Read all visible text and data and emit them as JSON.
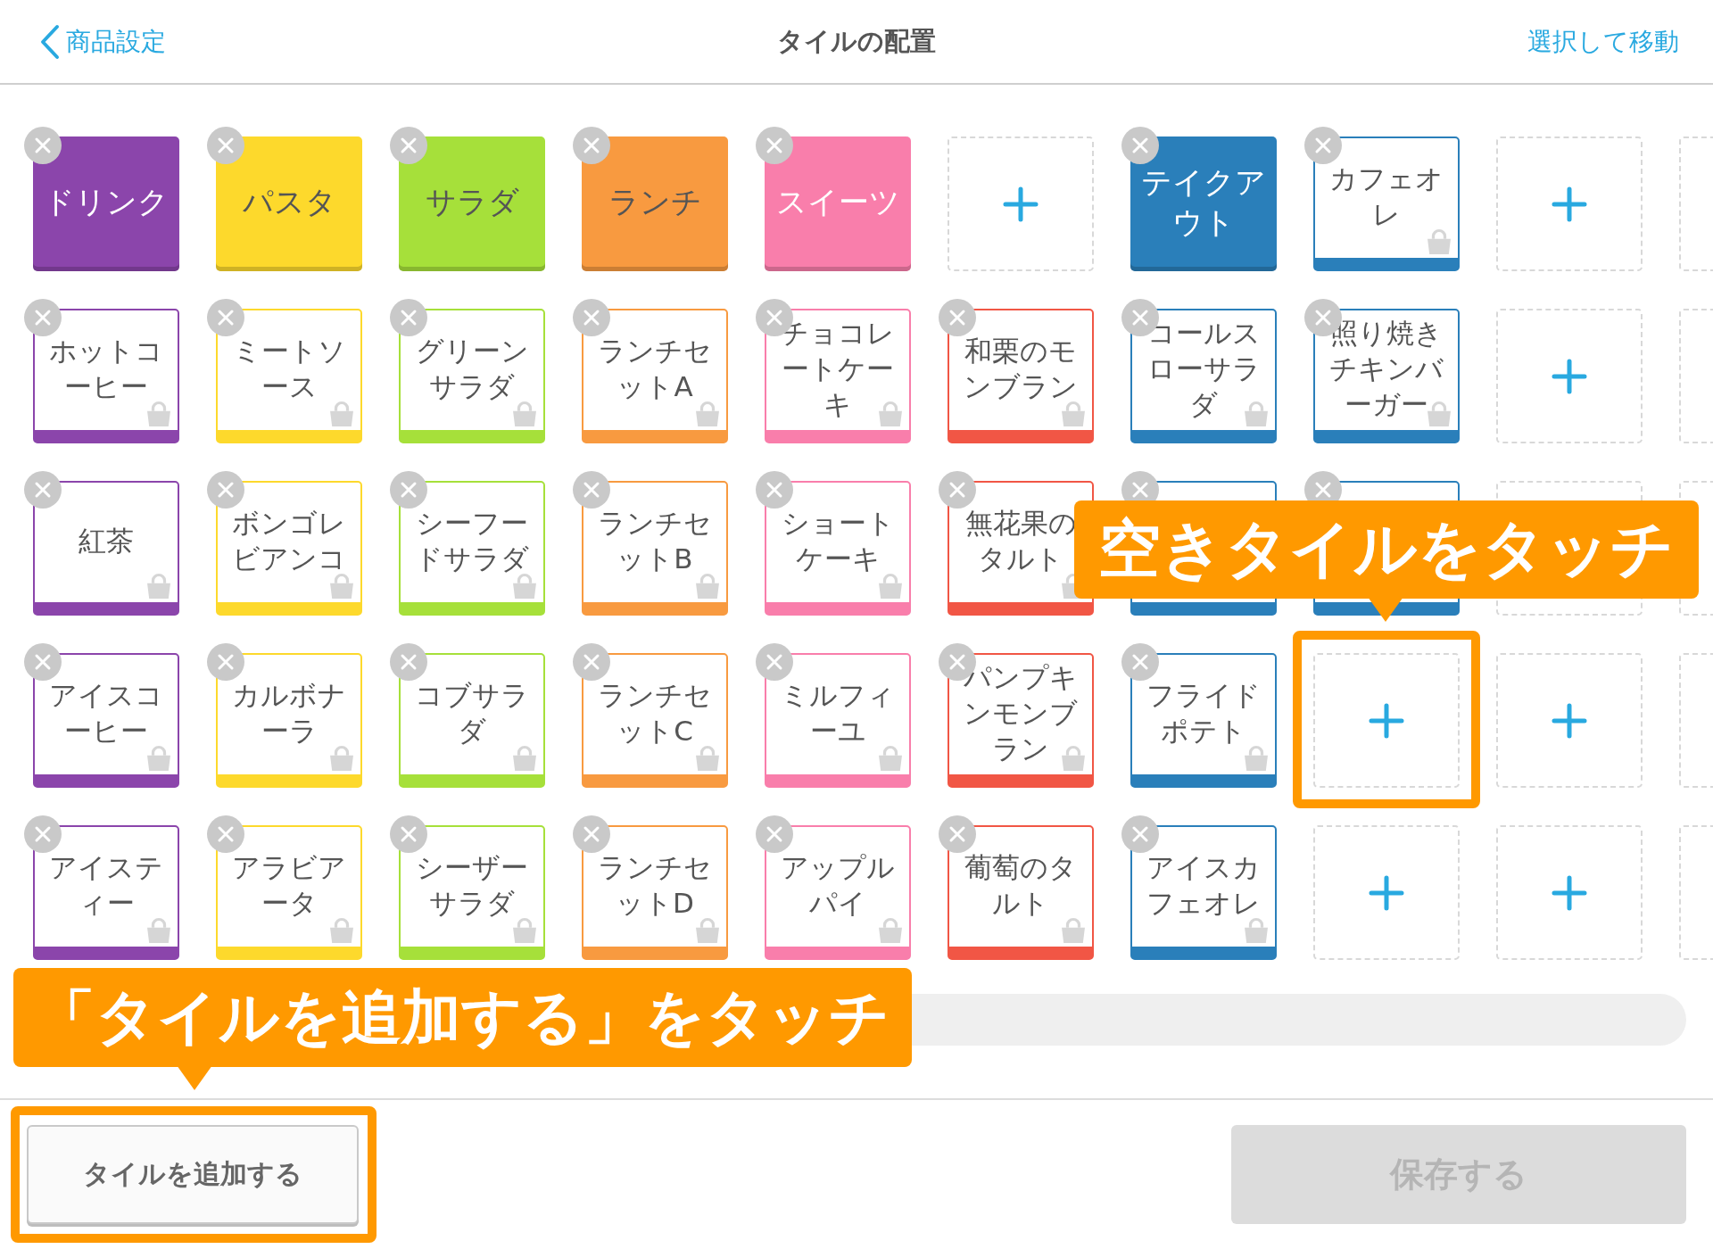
{
  "header": {
    "back_label": "商品設定",
    "title": "タイルの配置",
    "action": "選択して移動"
  },
  "tile_rows": [
    [
      {
        "kind": "category",
        "name": "ドリンク",
        "color": "#8b45ab"
      },
      {
        "kind": "category",
        "name": "パスタ",
        "color": "#fdd92c"
      },
      {
        "kind": "category",
        "name": "サラダ",
        "color": "#a6e03a"
      },
      {
        "kind": "category",
        "name": "ランチ",
        "color": "#f89a40"
      },
      {
        "kind": "category",
        "name": "スイーツ",
        "color": "#f97eab"
      },
      {
        "kind": "empty"
      },
      {
        "kind": "category",
        "name": "テイクアウト",
        "color": "#2a7fba"
      },
      {
        "kind": "item",
        "name": "カフェオレ",
        "color": "#2a7fba"
      },
      {
        "kind": "empty"
      },
      {
        "kind": "partial"
      }
    ],
    [
      {
        "kind": "item",
        "name": "ホットコーヒー",
        "color": "#8b45ab"
      },
      {
        "kind": "item",
        "name": "ミートソース",
        "color": "#fdd92c"
      },
      {
        "kind": "item",
        "name": "グリーンサラダ",
        "color": "#a6e03a"
      },
      {
        "kind": "item",
        "name": "ランチセットA",
        "color": "#f89a40"
      },
      {
        "kind": "item",
        "name": "チョコレートケーキ",
        "color": "#f97eab"
      },
      {
        "kind": "item",
        "name": "和栗のモンブラン",
        "color": "#f15645"
      },
      {
        "kind": "item",
        "name": "コールスローサラダ",
        "color": "#2a7fba"
      },
      {
        "kind": "item",
        "name": "照り焼きチキンバーガー",
        "color": "#2a7fba"
      },
      {
        "kind": "empty"
      },
      {
        "kind": "partial"
      }
    ],
    [
      {
        "kind": "item",
        "name": "紅茶",
        "color": "#8b45ab"
      },
      {
        "kind": "item",
        "name": "ボンゴレビアンコ",
        "color": "#fdd92c"
      },
      {
        "kind": "item",
        "name": "シーフードサラダ",
        "color": "#a6e03a"
      },
      {
        "kind": "item",
        "name": "ランチセットB",
        "color": "#f89a40"
      },
      {
        "kind": "item",
        "name": "ショートケーキ",
        "color": "#f97eab"
      },
      {
        "kind": "item",
        "name": "無花果のタルト",
        "color": "#f15645"
      },
      {
        "kind": "item",
        "color": "#2a7fba"
      },
      {
        "kind": "item",
        "color": "#2a7fba"
      },
      {
        "kind": "blank"
      },
      {
        "kind": "partial"
      }
    ],
    [
      {
        "kind": "item",
        "name": "アイスコーヒー",
        "color": "#8b45ab"
      },
      {
        "kind": "item",
        "name": "カルボナーラ",
        "color": "#fdd92c"
      },
      {
        "kind": "item",
        "name": "コブサラダ",
        "color": "#a6e03a"
      },
      {
        "kind": "item",
        "name": "ランチセットC",
        "color": "#f89a40"
      },
      {
        "kind": "item",
        "name": "ミルフィーユ",
        "color": "#f97eab"
      },
      {
        "kind": "item",
        "name": "パンプキンモンブラン",
        "color": "#f15645"
      },
      {
        "kind": "item",
        "name": "フライドポテト",
        "color": "#2a7fba"
      },
      {
        "kind": "empty"
      },
      {
        "kind": "empty"
      },
      {
        "kind": "partial"
      }
    ],
    [
      {
        "kind": "item",
        "name": "アイスティー",
        "color": "#8b45ab"
      },
      {
        "kind": "item",
        "name": "アラビアータ",
        "color": "#fdd92c"
      },
      {
        "kind": "item",
        "name": "シーザーサラダ",
        "color": "#a6e03a"
      },
      {
        "kind": "item",
        "name": "ランチセットD",
        "color": "#f89a40"
      },
      {
        "kind": "item",
        "name": "アップルパイ",
        "color": "#f97eab"
      },
      {
        "kind": "item",
        "name": "葡萄のタルト",
        "color": "#f15645"
      },
      {
        "kind": "item",
        "name": "アイスカフェオレ",
        "color": "#2a7fba"
      },
      {
        "kind": "empty"
      },
      {
        "kind": "empty"
      },
      {
        "kind": "partial"
      }
    ]
  ],
  "footer": {
    "add_button": "タイルを追加する",
    "save_button": {
      "label": "保存する",
      "disabled": true
    }
  },
  "callouts": [
    {
      "text": "空きタイルをタッチ"
    },
    {
      "text": "「タイルを追加する」をタッチ"
    }
  ]
}
